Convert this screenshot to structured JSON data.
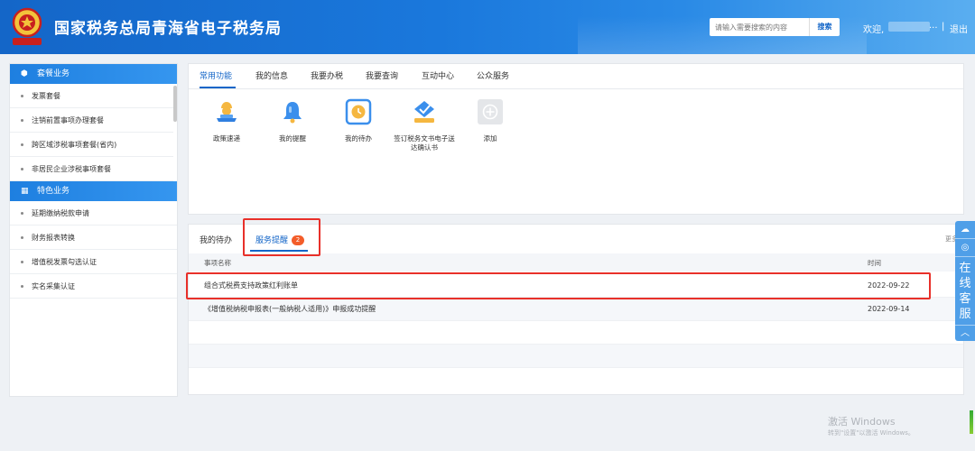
{
  "header": {
    "title": "国家税务总局青海省电子税务局",
    "search_placeholder": "请输入需要搜索的内容",
    "search_button": "搜索",
    "welcome": "欢迎,",
    "ellipsis": "...",
    "separator": "|",
    "logout": "退出"
  },
  "sidebar": {
    "sections": [
      {
        "title": "套餐业务",
        "icon": "cube-icon",
        "items": [
          "发票套餐",
          "注销前置事项办理套餐",
          "跨区域涉税事项套餐(省内)",
          "非居民企业涉税事项套餐"
        ]
      },
      {
        "title": "特色业务",
        "icon": "grid-icon",
        "items": [
          "延期缴纳税款申请",
          "财务报表转换",
          "增值税发票勾选认证",
          "实名采集认证"
        ]
      }
    ]
  },
  "top_panel": {
    "tabs": [
      "常用功能",
      "我的信息",
      "我要办税",
      "我要查询",
      "互动中心",
      "公众服务"
    ],
    "active_tab": 0,
    "functions": [
      {
        "label": "政策速递",
        "icon": "policy-bell-icon"
      },
      {
        "label": "我的提醒",
        "icon": "reminder-bell-icon"
      },
      {
        "label": "我的待办",
        "icon": "todo-clock-icon"
      },
      {
        "label": "签订税务文书电子送达确认书",
        "icon": "sign-document-icon"
      },
      {
        "label": "添加",
        "icon": "add-icon"
      }
    ]
  },
  "bottom_panel": {
    "tabs": [
      "我的待办",
      "服务提醒"
    ],
    "active_tab": 1,
    "badge": "2",
    "more": "更多",
    "columns": {
      "name": "事项名称",
      "time": "时间"
    },
    "rows": [
      {
        "name": "组合式税费支持政策红利账单",
        "time": "2022-09-22"
      },
      {
        "name": "《增值税纳税申报表(一般纳税人适用)》申报成功提醒",
        "time": "2022-09-14"
      }
    ]
  },
  "float_service": {
    "text": [
      "在",
      "线",
      "客",
      "服"
    ],
    "up": "︿"
  },
  "watermark": {
    "line1": "激活 Windows",
    "line2": "转到\"设置\"以激活 Windows。"
  },
  "colors": {
    "primary": "#1466c8",
    "badge": "#f35d2a",
    "highlight": "#e8302a",
    "float": "#4f9fe8"
  }
}
